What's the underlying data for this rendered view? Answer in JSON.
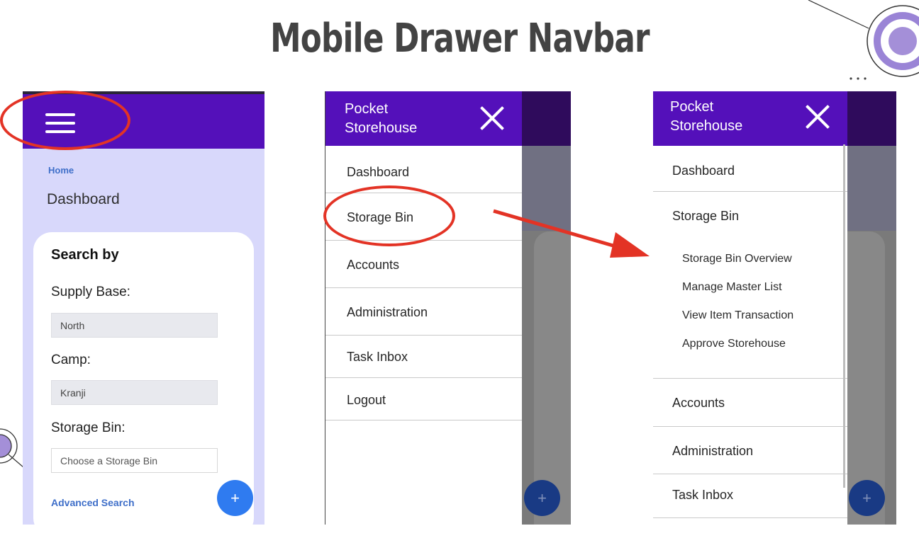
{
  "slide_title": "Mobile Drawer Navbar",
  "screen_before": {
    "breadcrumb": "Home",
    "page_title": "Dashboard",
    "search_card": {
      "title": "Search by",
      "fields": [
        {
          "label": "Supply Base:",
          "value": "North"
        },
        {
          "label": "Camp:",
          "value": "Kranji"
        },
        {
          "label": "Storage Bin:",
          "placeholder": "Choose a Storage Bin"
        }
      ],
      "advanced_search": "Advanced Search"
    },
    "fab": "+"
  },
  "drawer_collapsed": {
    "brand_line1": "Pocket",
    "brand_line2": "Storehouse",
    "items": [
      "Dashboard",
      "Storage Bin",
      "Accounts",
      "Administration",
      "Task Inbox",
      "Logout"
    ],
    "highlighted_item": "Storage Bin"
  },
  "drawer_expanded": {
    "brand_line1": "Pocket",
    "brand_line2": "Storehouse",
    "items_before": [
      "Dashboard",
      "Storage Bin"
    ],
    "sub_items": [
      "Storage Bin Overview",
      "Manage Master List",
      "View Item Transaction",
      "Approve Storehouse"
    ],
    "items_after": [
      "Accounts",
      "Administration",
      "Task Inbox"
    ]
  },
  "fab_dark": "+",
  "colors": {
    "appbar": "#5410ba",
    "page_bg": "#d8d8fb",
    "link": "#3f6fc9",
    "fab": "#2f7bf0",
    "annotation": "#e33325",
    "deco_circle": "#a48fd8"
  }
}
